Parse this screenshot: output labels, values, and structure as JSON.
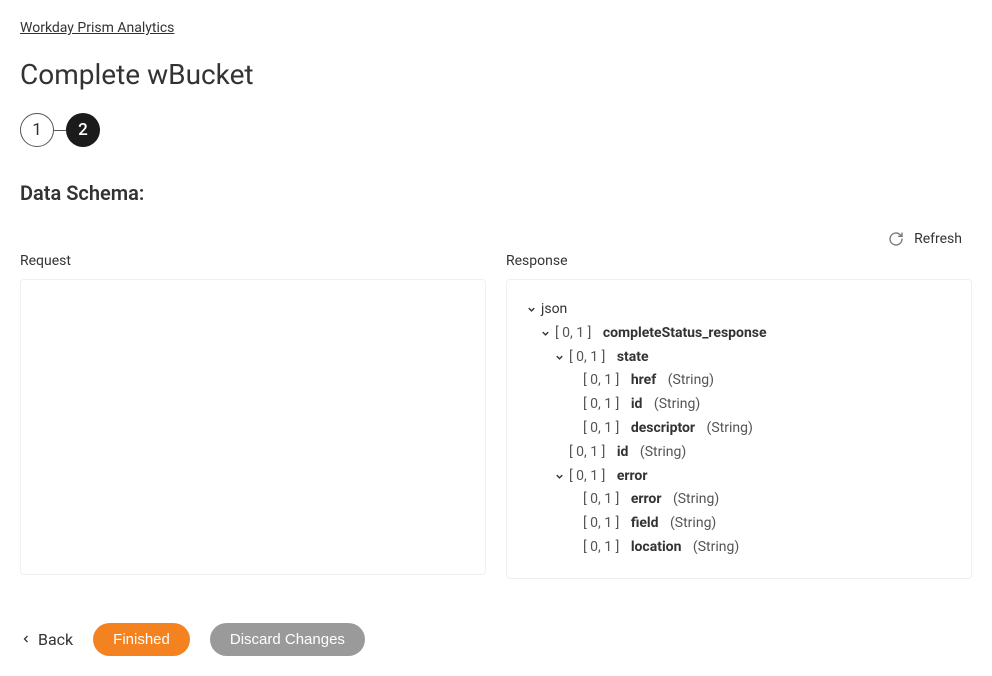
{
  "breadcrumb": "Workday Prism Analytics",
  "page_title": "Complete wBucket",
  "stepper": {
    "step1": "1",
    "step2": "2"
  },
  "section_title": "Data Schema:",
  "refresh_label": "Refresh",
  "columns": {
    "request_label": "Request",
    "response_label": "Response"
  },
  "tree": {
    "root": "json",
    "n1": {
      "range": "[ 0, 1 ]",
      "name": "completeStatus_response"
    },
    "n2": {
      "range": "[ 0, 1 ]",
      "name": "state"
    },
    "n3": {
      "range": "[ 0, 1 ]",
      "name": "href",
      "type": "(String)"
    },
    "n4": {
      "range": "[ 0, 1 ]",
      "name": "id",
      "type": "(String)"
    },
    "n5": {
      "range": "[ 0, 1 ]",
      "name": "descriptor",
      "type": "(String)"
    },
    "n6": {
      "range": "[ 0, 1 ]",
      "name": "id",
      "type": "(String)"
    },
    "n7": {
      "range": "[ 0, 1 ]",
      "name": "error"
    },
    "n8": {
      "range": "[ 0, 1 ]",
      "name": "error",
      "type": "(String)"
    },
    "n9": {
      "range": "[ 0, 1 ]",
      "name": "field",
      "type": "(String)"
    },
    "n10": {
      "range": "[ 0, 1 ]",
      "name": "location",
      "type": "(String)"
    }
  },
  "footer": {
    "back": "Back",
    "finished": "Finished",
    "discard": "Discard Changes"
  }
}
